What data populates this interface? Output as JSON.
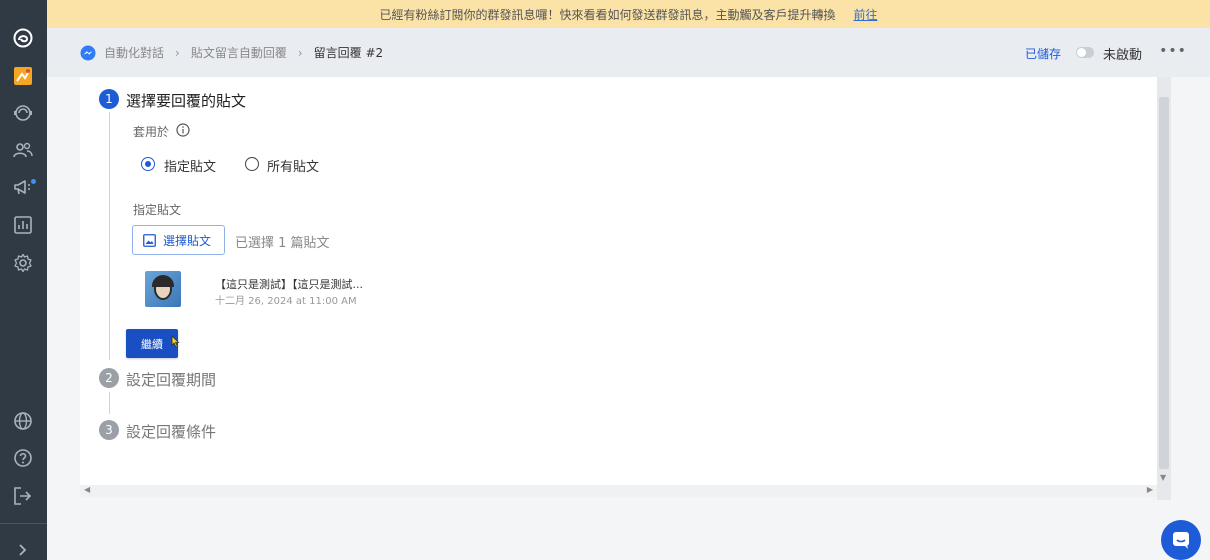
{
  "sidebar": {
    "icons": [
      "brand-logo-icon",
      "inbox-icon",
      "automation-bot-icon",
      "contacts-icon",
      "broadcast-icon",
      "analytics-icon",
      "settings-icon",
      "globe-icon",
      "help-icon",
      "logout-icon",
      "expand-chevron-icon"
    ]
  },
  "banner": {
    "text": "已經有粉絲訂閱你的群發訊息囉！快來看看如何發送群發訊息，主動觸及客戶提升轉換",
    "link": "前往"
  },
  "header": {
    "breadcrumbs": [
      "自動化對話",
      "貼文留言自動回覆",
      "留言回覆 #2"
    ],
    "saved": "已儲存",
    "toggle_label": "未啟動",
    "more": "•••"
  },
  "steps": [
    {
      "number": "1",
      "title": "選擇要回覆的貼文"
    },
    {
      "number": "2",
      "title": "設定回覆期間"
    },
    {
      "number": "3",
      "title": "設定回覆條件"
    }
  ],
  "step1": {
    "apply_label": "套用於",
    "options": [
      {
        "label": "指定貼文",
        "checked": true
      },
      {
        "label": "所有貼文",
        "checked": false
      }
    ],
    "specific_label": "指定貼文",
    "select_button": "選擇貼文",
    "selected_text": "已選擇 1 篇貼文",
    "post": {
      "title": "【這只是測試】【這只是測試...",
      "date": "十二月 26, 2024 at 11:00 AM"
    },
    "continue_button": "繼續"
  },
  "colors": {
    "primary": "#1e5bd6",
    "sidebar": "#2f3a45",
    "banner": "#fbe3a7"
  }
}
